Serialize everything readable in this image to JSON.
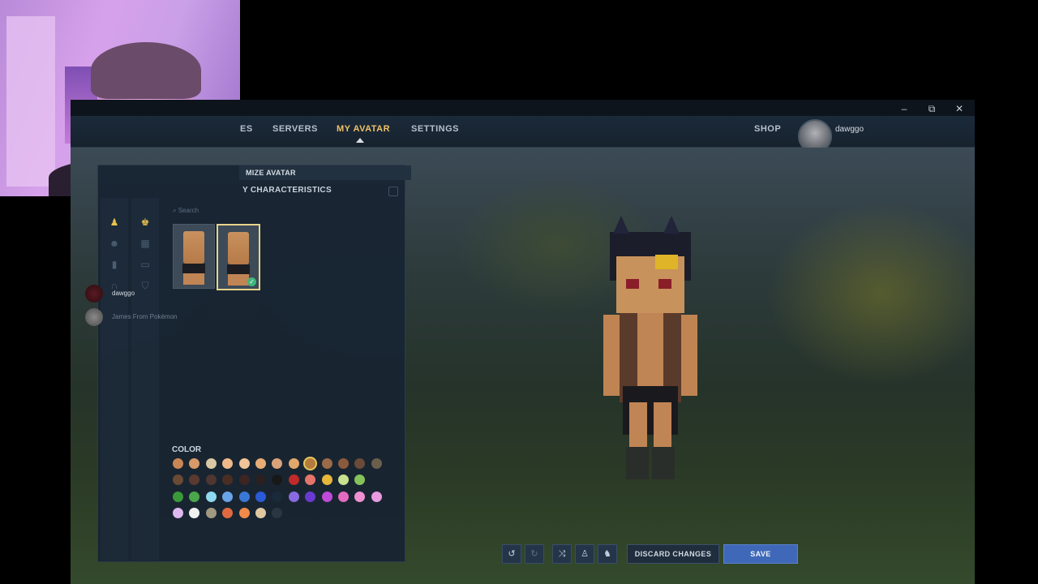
{
  "window": {
    "controls": {
      "minimize": "–",
      "restore": "⧉",
      "close": "✕"
    }
  },
  "nav": {
    "items": [
      {
        "label": "ES"
      },
      {
        "label": "SERVERS"
      },
      {
        "label": "MY AVATAR",
        "active": true
      },
      {
        "label": "SETTINGS"
      }
    ],
    "shop": "SHOP",
    "username": "dawggo"
  },
  "panel": {
    "header": "MIZE AVATAR",
    "subheader": "Y CHARACTERISTICS",
    "search_placeholder": "Search",
    "color_title": "COLOR",
    "profiles": [
      {
        "name": "dawggo"
      },
      {
        "name": "James From Pokémon"
      }
    ]
  },
  "colors": {
    "rows": [
      [
        "#c98655",
        "#d79a68",
        "#d8c8a4",
        "#f0b98a",
        "#f2c49a",
        "#e8ad75",
        "#d9a27a",
        "#e2a76b",
        "#b37b3c",
        "#9b6a48",
        "#8b5a3c",
        "#6a4a38",
        "#6b5e4a"
      ],
      [
        "#6a4a33",
        "#5a3a30",
        "#4f3630",
        "#4a2e24",
        "#3c2522",
        "#2a2020",
        "#181818",
        "#c02a2a",
        "#e5756a",
        "#e6b73a",
        "#c9e08f",
        "#86c25a"
      ],
      [
        "#3a9a3a",
        "#4aa84a",
        "#8fd9f0",
        "#6aa4e8",
        "#3a78d8",
        "#2a5ad6",
        "#1a2a3a",
        "#8a6ae0",
        "#6a3ad0",
        "#c04ad8",
        "#e66ac0",
        "#f090d0",
        "#e89ae0"
      ],
      [
        "#e0b8f0",
        "#f0f0f0",
        "#a09a80",
        "#e06a40",
        "#f08a4a",
        "#e0c8a0",
        "#2c3640"
      ]
    ],
    "selected": [
      0,
      8
    ]
  },
  "actions": {
    "undo_icon": "↺",
    "redo_icon": "↻",
    "random_icon": "⤨",
    "discard": "DISCARD CHANGES",
    "save": "SAVE"
  }
}
